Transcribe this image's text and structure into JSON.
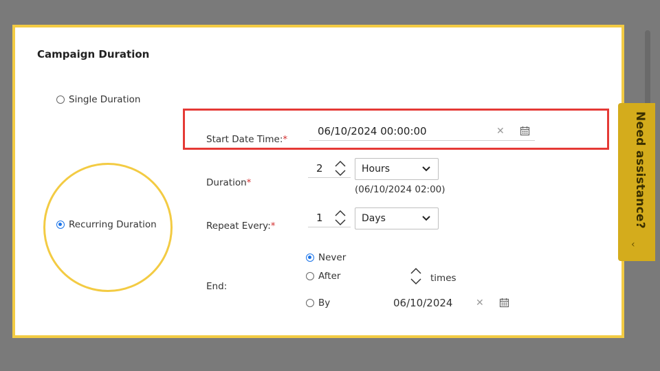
{
  "section": {
    "title": "Campaign Duration"
  },
  "duration_type": {
    "single_label": "Single Duration",
    "recurring_label": "Recurring Duration",
    "selected": "Recurring Duration"
  },
  "start": {
    "label": "Start Date Time:",
    "required": "*",
    "value": "06/10/2024 00:00:00"
  },
  "duration": {
    "label": "Duration",
    "required": "*",
    "value": "2",
    "unit": "Hours",
    "end_preview": "(06/10/2024 02:00)"
  },
  "repeat": {
    "label": "Repeat Every:",
    "required": "*",
    "value": "1",
    "unit": "Days"
  },
  "end": {
    "label": "End:",
    "never_label": "Never",
    "after_label": "After",
    "times_label": "times",
    "by_label": "By",
    "by_date": "06/10/2024",
    "selected": "Never"
  },
  "assistance": {
    "label": "Need assistance?"
  },
  "colors": {
    "highlight_yellow": "#f3cb43",
    "highlight_red": "#e53935",
    "radio_blue": "#1a73e8",
    "tab_gold": "#d4ac1c"
  }
}
